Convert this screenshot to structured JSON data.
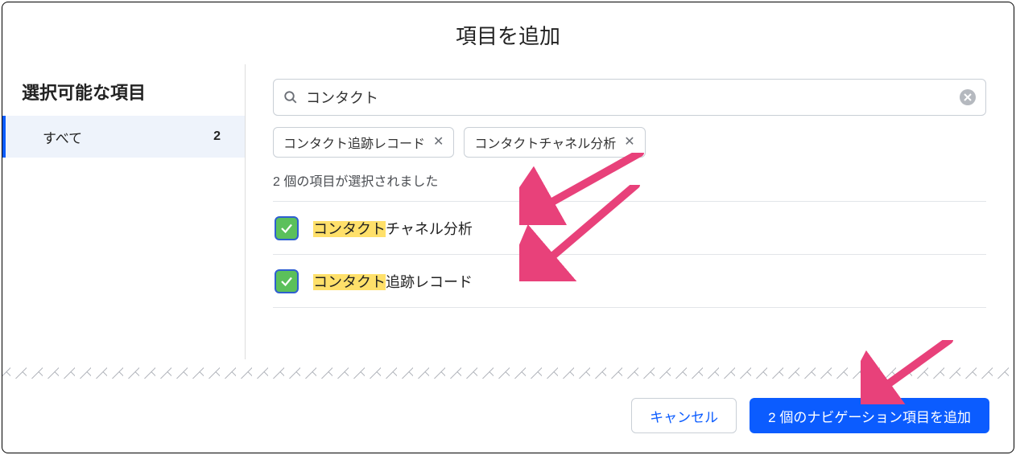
{
  "modal": {
    "title": "項目を追加"
  },
  "sidebar": {
    "title": "選択可能な項目",
    "all_label": "すべて",
    "all_count": "2"
  },
  "search": {
    "value": "コンタクト"
  },
  "chips": [
    {
      "label": "コンタクト追跡レコード"
    },
    {
      "label": "コンタクトチャネル分析"
    }
  ],
  "selected_count_text": "2 個の項目が選択されました",
  "items": [
    {
      "highlight": "コンタクト",
      "rest": "チャネル分析"
    },
    {
      "highlight": "コンタクト",
      "rest": "追跡レコード"
    }
  ],
  "footer": {
    "cancel": "キャンセル",
    "confirm": "2 個のナビゲーション項目を追加"
  }
}
